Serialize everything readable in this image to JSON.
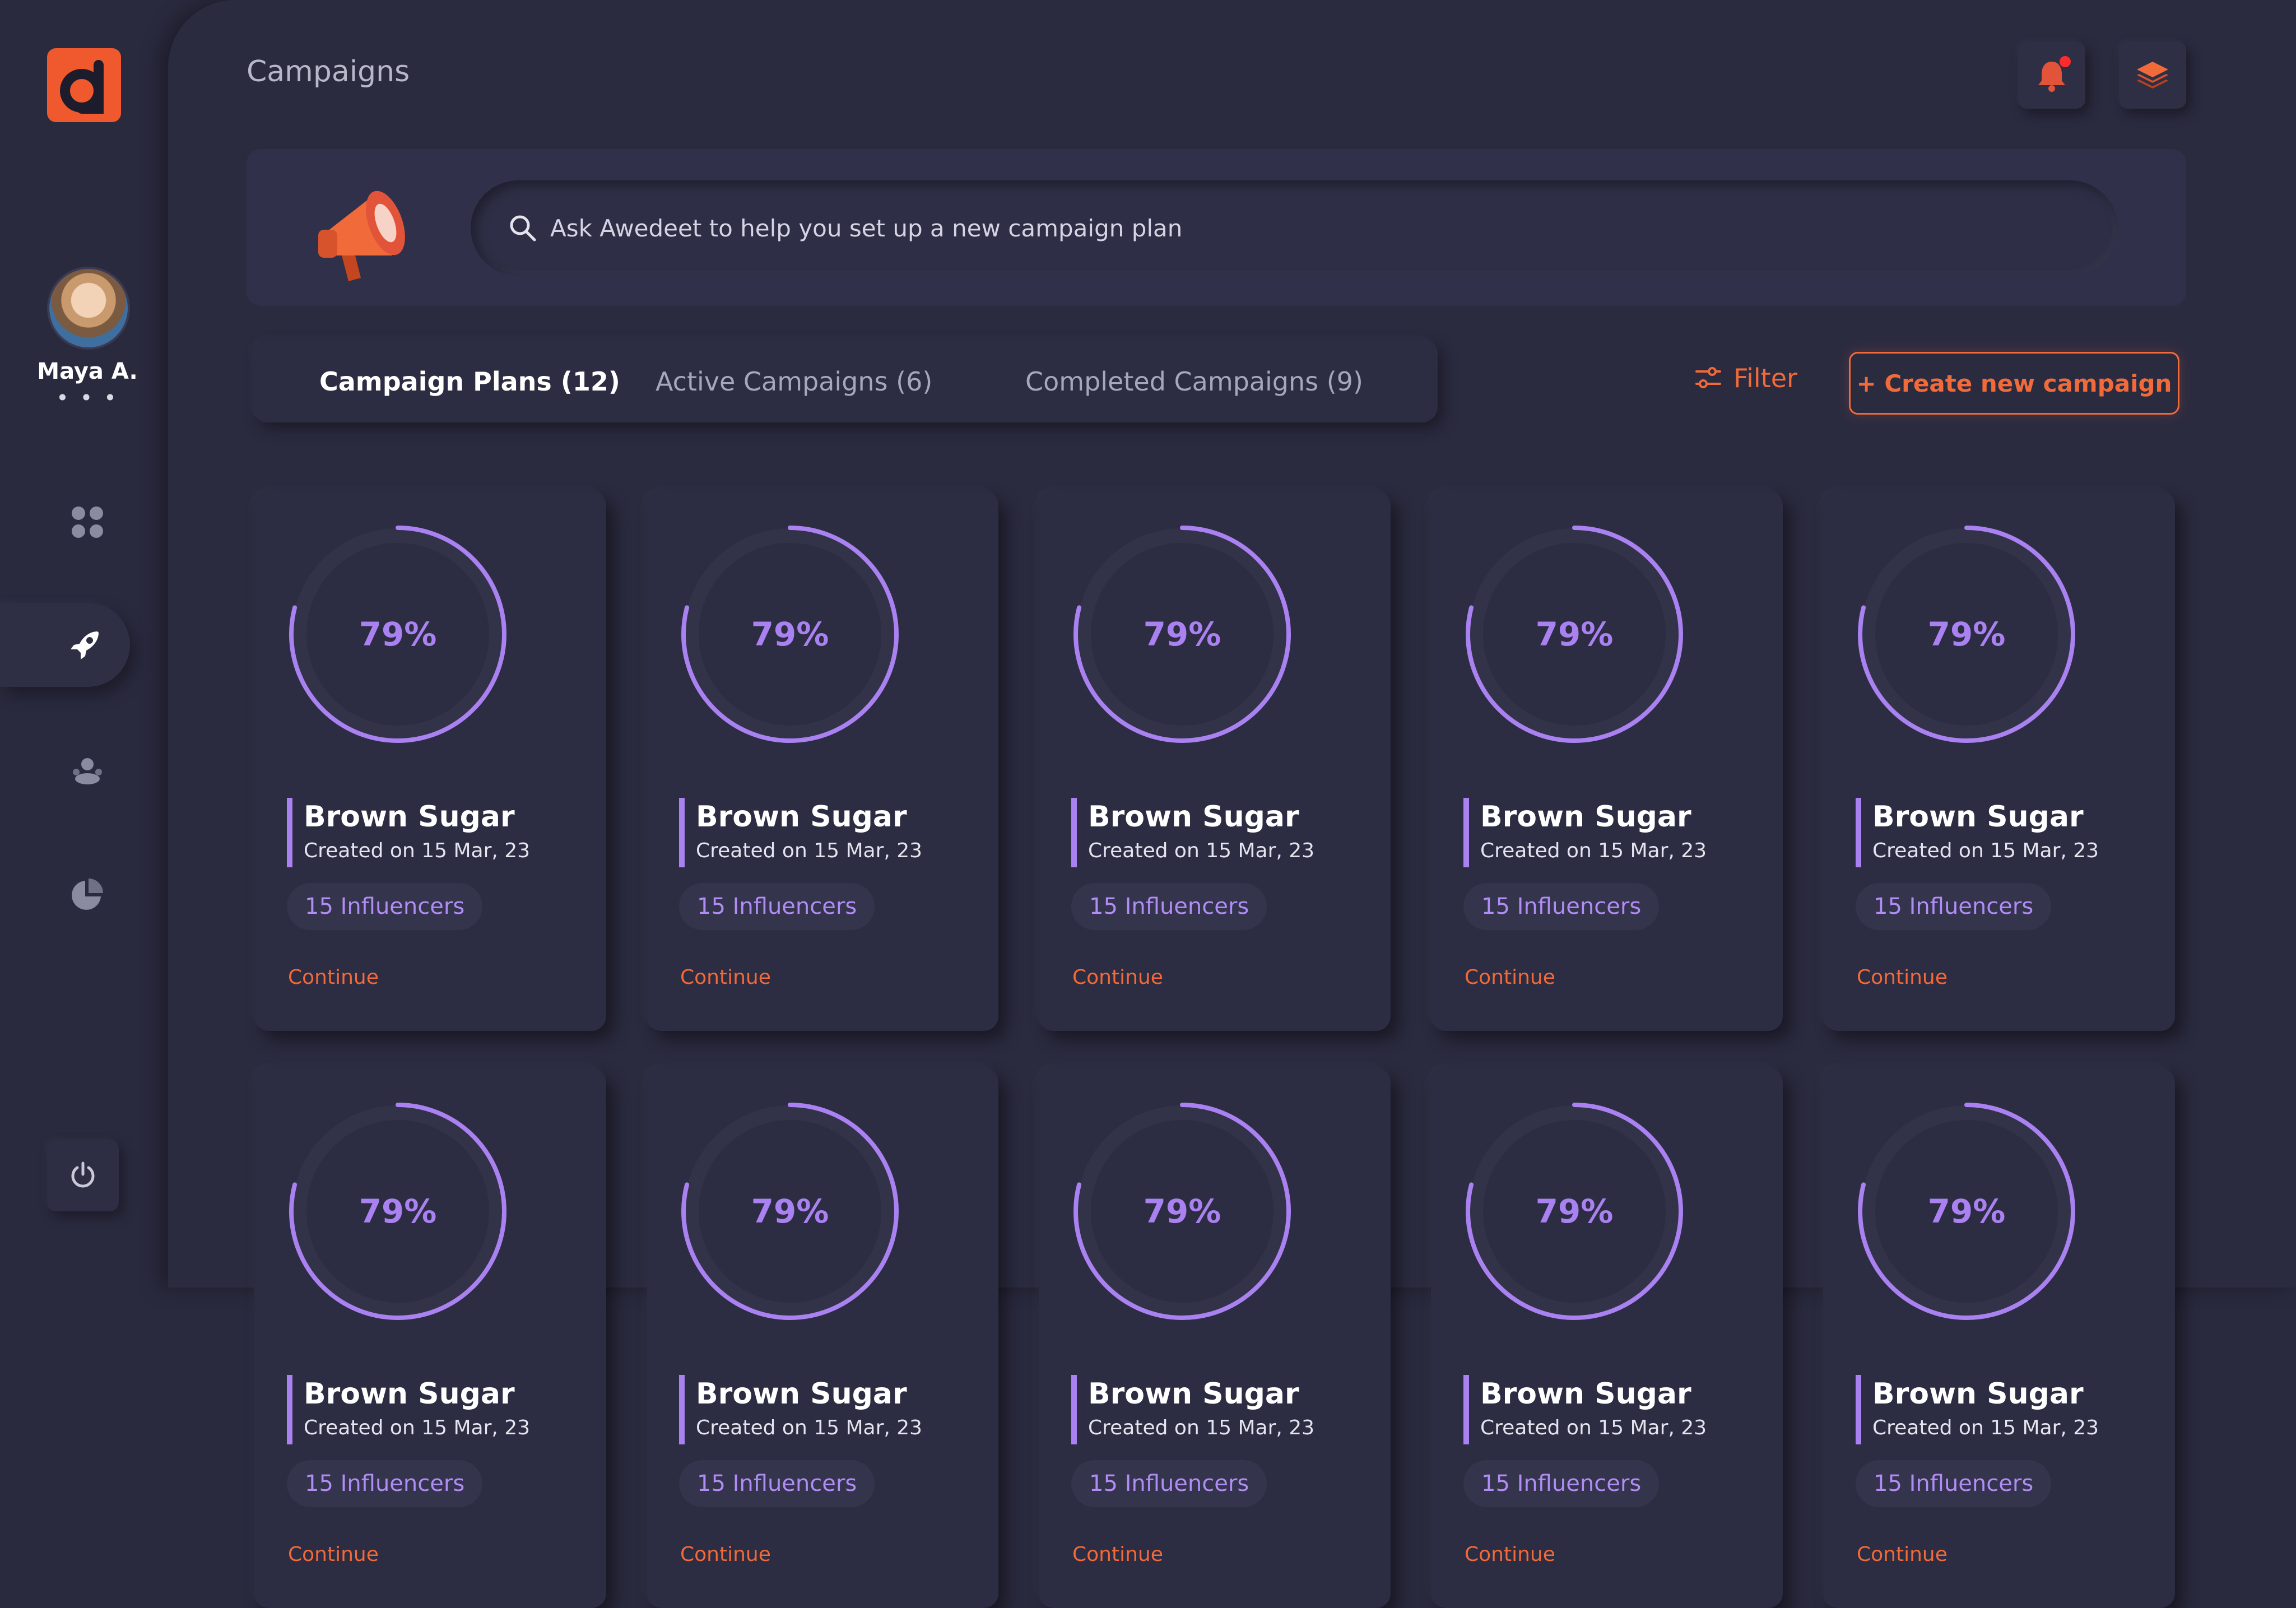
{
  "sidebar": {
    "user_name": "Maya A.",
    "more": "• • •",
    "nav": [
      {
        "name": "dashboard",
        "icon": "grid-icon"
      },
      {
        "name": "campaigns",
        "icon": "rocket-icon",
        "active": true
      },
      {
        "name": "influencers",
        "icon": "users-icon"
      },
      {
        "name": "analytics",
        "icon": "pie-chart-icon"
      }
    ],
    "power_icon": "power-icon"
  },
  "header": {
    "title": "Campaigns",
    "notification_icon": "bell-icon",
    "layers_icon": "layers-icon"
  },
  "search": {
    "placeholder": "Ask Awedeet to help you set up a new campaign plan",
    "value": ""
  },
  "tabs": [
    {
      "label": "Campaign Plans (12)",
      "active": true
    },
    {
      "label": "Active Campaigns (6)",
      "active": false
    },
    {
      "label": "Completed Campaigns (9)",
      "active": false
    }
  ],
  "filter_label": "Filter",
  "create_label": "+ Create new campaign",
  "colors": {
    "accent": "#f06a3a",
    "purple": "#a981f0",
    "background": "#2b2b40"
  },
  "cards": [
    {
      "progress_label": "79%",
      "progress": 0.79,
      "name": "Brown Sugar",
      "created": "Created on 15 Mar, 23",
      "influencers": "15 Influencers",
      "action": "Continue"
    },
    {
      "progress_label": "79%",
      "progress": 0.79,
      "name": "Brown Sugar",
      "created": "Created on 15 Mar, 23",
      "influencers": "15 Influencers",
      "action": "Continue"
    },
    {
      "progress_label": "79%",
      "progress": 0.79,
      "name": "Brown Sugar",
      "created": "Created on 15 Mar, 23",
      "influencers": "15 Influencers",
      "action": "Continue"
    },
    {
      "progress_label": "79%",
      "progress": 0.79,
      "name": "Brown Sugar",
      "created": "Created on 15 Mar, 23",
      "influencers": "15 Influencers",
      "action": "Continue"
    },
    {
      "progress_label": "79%",
      "progress": 0.79,
      "name": "Brown Sugar",
      "created": "Created on 15 Mar, 23",
      "influencers": "15 Influencers",
      "action": "Continue"
    },
    {
      "progress_label": "79%",
      "progress": 0.79,
      "name": "Brown Sugar",
      "created": "Created on 15 Mar, 23",
      "influencers": "15 Influencers",
      "action": "Continue"
    },
    {
      "progress_label": "79%",
      "progress": 0.79,
      "name": "Brown Sugar",
      "created": "Created on 15 Mar, 23",
      "influencers": "15 Influencers",
      "action": "Continue"
    },
    {
      "progress_label": "79%",
      "progress": 0.79,
      "name": "Brown Sugar",
      "created": "Created on 15 Mar, 23",
      "influencers": "15 Influencers",
      "action": "Continue"
    },
    {
      "progress_label": "79%",
      "progress": 0.79,
      "name": "Brown Sugar",
      "created": "Created on 15 Mar, 23",
      "influencers": "15 Influencers",
      "action": "Continue"
    },
    {
      "progress_label": "79%",
      "progress": 0.79,
      "name": "Brown Sugar",
      "created": "Created on 15 Mar, 23",
      "influencers": "15 Influencers",
      "action": "Continue"
    }
  ]
}
